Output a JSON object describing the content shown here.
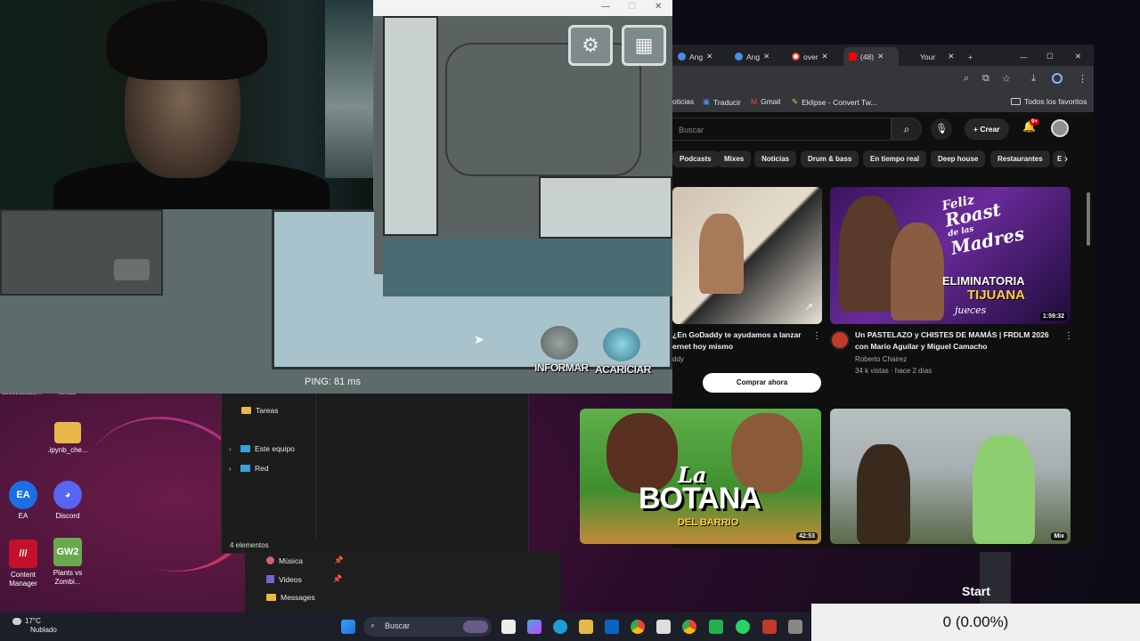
{
  "desktop": {
    "icons": [
      {
        "label": "EA",
        "name": "ea-app-icon",
        "color": "#1b6ee6"
      },
      {
        "label": "Discord",
        "name": "discord-app-icon",
        "color": "#5865f2"
      },
      {
        "label": "Content Manager",
        "name": "content-manager-app-icon",
        "color": "#c4102a"
      },
      {
        "label": "Plants vs Zombi...",
        "name": "plants-vs-zombies-app-icon",
        "color": "#6aa84f"
      },
      {
        "label": ".ipynb_che...",
        "name": "ipynb-folder-icon",
        "color": "#e8b84a"
      }
    ],
    "partial_label_left": "5255252525...",
    "partial_label_tareas": "Tareas"
  },
  "explorer": {
    "nav": [
      {
        "label": "Tareas"
      },
      {
        "label": "Este equipo"
      },
      {
        "label": "Red"
      }
    ],
    "status": "4 elementos",
    "quick_access": [
      {
        "label": "Música"
      },
      {
        "label": "Videos"
      },
      {
        "label": "Messages"
      }
    ]
  },
  "chrome": {
    "tabs": [
      {
        "label": "Ang"
      },
      {
        "label": "Ang"
      },
      {
        "label": "over"
      },
      {
        "label": "(48)"
      },
      {
        "label": "Your"
      }
    ],
    "bookmarks": [
      {
        "label": "oticias"
      },
      {
        "label": "Traducir"
      },
      {
        "label": "Gmail"
      },
      {
        "label": "Eklipse - Convert Tw..."
      },
      {
        "label": "Todos los favoritos"
      }
    ],
    "youtube": {
      "search_placeholder": "Buscar",
      "create_label": "Crear",
      "notification_count": "9+",
      "chips": [
        "Podcasts",
        "Mixes",
        "Noticias",
        "Drum & bass",
        "En tiempo real",
        "Deep house",
        "Restaurantes",
        "E"
      ],
      "videos": [
        {
          "title": "¿En GoDaddy te ayudamos a lanzar ernet hoy mismo",
          "channel": "ddy",
          "meta": "",
          "duration": ""
        },
        {
          "title": "Un PASTELAZO y CHISTES DE MAMÁS | FRDLM 2026 con Mario Aguilar y Miguel Camacho",
          "channel": "Roberto Chairez",
          "meta": "34 k vistas · hace 2 días",
          "duration": "1:59:32"
        },
        {
          "title": "",
          "channel": "",
          "meta": "",
          "duration": "42:53"
        },
        {
          "title": "",
          "channel": "",
          "meta": "",
          "duration": "Mix"
        }
      ],
      "thumb_texts": {
        "roast_1": "Feliz",
        "roast_2": "Roast",
        "roast_3": "de las",
        "roast_4": "Madres",
        "roast_5": "ELIMINATORIA",
        "roast_6": "TIJUANA",
        "roast_7": "jueces",
        "botana_1": "La",
        "botana_2": "BOTANA",
        "botana_3": "DEL BARRIO"
      },
      "buy_button": "Comprar ahora"
    }
  },
  "game": {
    "ping": "PING: 81 ms",
    "report_label": "INFORMAR",
    "pet_label": "ACARICIAR"
  },
  "taskbar": {
    "weather_temp": "17°C",
    "weather_desc": "Nublado",
    "search_placeholder": "Buscar"
  },
  "overlay": {
    "start_label": "Start",
    "counter": "0 (0.00%)"
  }
}
